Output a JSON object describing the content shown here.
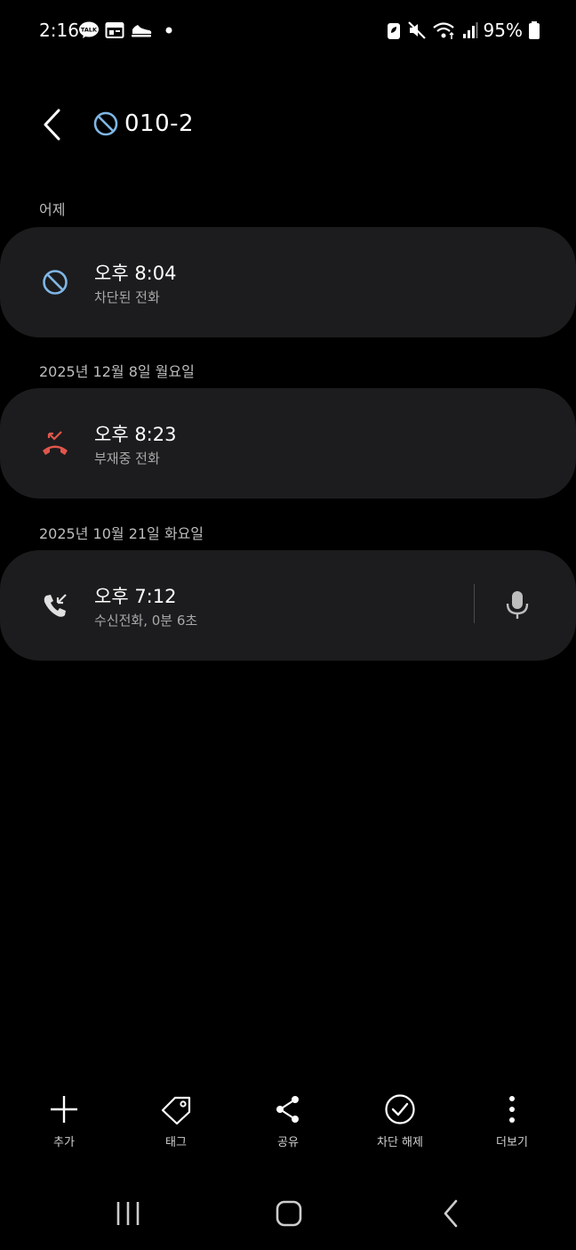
{
  "status_bar": {
    "time": "2:16",
    "battery": "95%",
    "left_icons": [
      "kakaotalk-icon",
      "calendar-icon",
      "shoe-icon",
      "dot-icon"
    ],
    "right_icons": [
      "battery-saver-icon",
      "mute-icon",
      "wifi-icon",
      "signal-icon",
      "battery-icon"
    ]
  },
  "header": {
    "title": "010-2"
  },
  "sections": [
    {
      "label": "어제",
      "entry": {
        "time": "오후 8:04",
        "subtitle": "차단된 전화",
        "icon": "blocked-call-icon"
      }
    },
    {
      "label": "2025년 12월 8일 월요일",
      "entry": {
        "time": "오후 8:23",
        "subtitle": "부재중 전화",
        "icon": "missed-call-icon"
      }
    },
    {
      "label": "2025년 10월 21일 화요일",
      "entry": {
        "time": "오후 7:12",
        "subtitle": "수신전화, 0분 6초",
        "icon": "incoming-call-icon"
      }
    }
  ],
  "toolbar": {
    "add": "추가",
    "tag": "태그",
    "share": "공유",
    "unblock": "차단 해제",
    "more": "더보기"
  },
  "colors": {
    "background": "#000000",
    "card": "#1c1c1e",
    "blocked_icon": "#7fb6e6",
    "missed_icon": "#e0564b"
  }
}
